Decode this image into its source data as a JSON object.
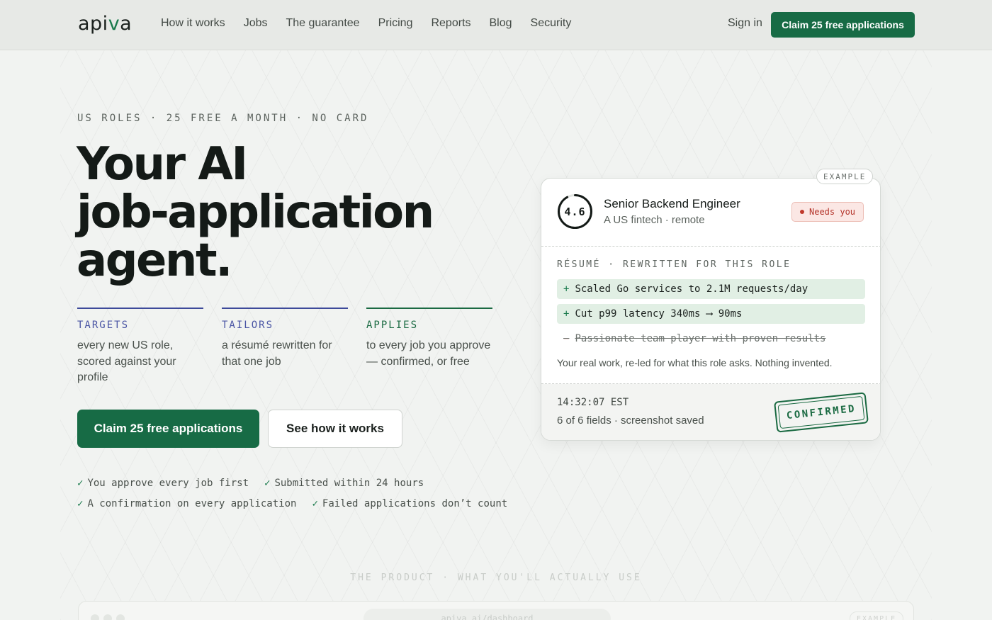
{
  "brand": {
    "logo_pre": "api",
    "logo_v": "v",
    "logo_post": "a"
  },
  "nav": {
    "links": [
      "How it works",
      "Jobs",
      "The guarantee",
      "Pricing",
      "Reports",
      "Blog",
      "Security"
    ],
    "sign_in": "Sign in",
    "cta": "Claim 25 free applications"
  },
  "hero": {
    "kicker": "US ROLES · 25 FREE A MONTH · NO CARD",
    "headline_1": "Your AI",
    "headline_2": "job-application",
    "headline_3": "agent.",
    "columns": [
      {
        "title": "TARGETS",
        "text": "every new US role, scored against your profile"
      },
      {
        "title": "TAILORS",
        "text": "a résumé rewritten for that one job"
      },
      {
        "title": "APPLIES",
        "text": "to every job you approve — confirmed, or free"
      }
    ],
    "primary_cta": "Claim 25 free applications",
    "secondary_cta": "See how it works",
    "checks": [
      "You approve every job first",
      "Submitted within 24 hours",
      "A confirmation on every application",
      "Failed applications don’t count"
    ],
    "check_mark": "✓"
  },
  "card": {
    "tag": "EXAMPLE",
    "score": "4.6",
    "score_fraction": 0.92,
    "job_title": "Senior Backend Engineer",
    "job_sub": "A US fintech · remote",
    "status": "Needs you",
    "resume_label": "RÉSUMÉ · REWRITTEN FOR THIS ROLE",
    "lines": [
      {
        "sign": "+",
        "text": "Scaled Go services to 2.1M requests/day"
      },
      {
        "sign": "+",
        "text": "Cut p99 latency 340ms ⟶ 90ms"
      },
      {
        "sign": "−",
        "text": "Passionate team player with proven results"
      }
    ],
    "note": "Your real work, re-led for what this role asks. Nothing invented.",
    "time": "14:32:07 EST",
    "fields": "6 of 6 fields · screenshot saved",
    "stamp": "CONFIRMED"
  },
  "product": {
    "label": "THE PRODUCT · WHAT YOU'LL ACTUALLY USE",
    "url": "apiva.ai/dashboard",
    "tag": "EXAMPLE"
  },
  "colors": {
    "accent": "#176b45",
    "indigo": "#4a55a4",
    "danger": "#c0392b"
  }
}
